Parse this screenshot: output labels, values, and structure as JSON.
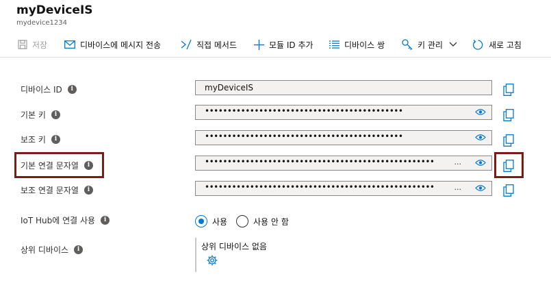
{
  "header": {
    "title": "myDeviceIS",
    "subtitle": "mydevice1234"
  },
  "toolbar": {
    "save": "저장",
    "send_message": "디바이스에 메시지 전송",
    "direct_method": "직접 메서드",
    "add_module_id": "모듈 ID 추가",
    "device_twin": "디바이스 쌍",
    "key_management": "키 관리",
    "refresh": "새로 고침"
  },
  "fields": {
    "device_id": {
      "label": "디바이스 ID",
      "value": "myDeviceIS"
    },
    "primary_key": {
      "label": "기본 키",
      "value": "••••••••••••••••••••••••••••••••••••••••••••"
    },
    "secondary_key": {
      "label": "보조 키",
      "value": "••••••••••••••••••••••••••••••••••••••••••••"
    },
    "primary_conn": {
      "label": "기본 연결 문자열",
      "value": "•••••••••••••••••••••••••••••••••••••••••••••••••••",
      "ellipsis": "..."
    },
    "secondary_conn": {
      "label": "보조 연결 문자열",
      "value": "•••••••••••••••••••••••••••••••••••••••••••••••••••",
      "ellipsis": "..."
    }
  },
  "iot_hub": {
    "label": "IoT Hub에 연결 사용",
    "option_enable": "사용",
    "option_disable": "사용 안 함",
    "selected": "사용"
  },
  "parent_device": {
    "label": "상위 디바이스",
    "value": "상위 디바이스 없음"
  },
  "info_glyph": "i",
  "colors": {
    "accent": "#0078d4",
    "highlight": "#7b1d16"
  },
  "icons": [
    "save-icon",
    "mail-icon",
    "direct-method-icon",
    "plus-icon",
    "list-icon",
    "key-icon",
    "chevron-down-icon",
    "refresh-icon",
    "info-icon",
    "eye-icon",
    "copy-icon",
    "gear-icon"
  ]
}
